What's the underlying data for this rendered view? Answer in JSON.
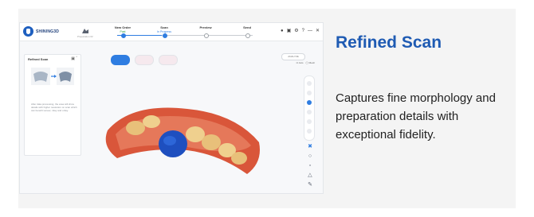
{
  "card": {
    "title": "Refined Scan",
    "description": "Captures fine morphology and preparation details with exceptional fidelity."
  },
  "app": {
    "logo_text": "SHINING3D",
    "doc_sub": "Preparation 02",
    "steps": [
      {
        "name": "New Order",
        "status": "Past",
        "status_color": "#2f9e44"
      },
      {
        "name": "Scan",
        "status": "In Progress",
        "status_color": "#2f7de1"
      },
      {
        "name": "Preview",
        "status": "",
        "status_color": "#999999"
      },
      {
        "name": "Send",
        "status": "",
        "status_color": "#999999"
      }
    ],
    "progress_fraction": 0.33,
    "window_controls": [
      "?",
      "—",
      "✕"
    ],
    "panel": {
      "title": "Refined Scan",
      "description": "After data processing, the area will show details with higher resolution on scan which can benefit veneer, inlay and onlay."
    },
    "toggle_label": "ANALYZE",
    "options": [
      "⊡ Axis",
      "◯ Mesh"
    ]
  },
  "colors": {
    "accent": "#2f7de1",
    "title_blue": "#1f5bb3",
    "gum": "#d9563a",
    "tooth": "#e8c07a",
    "highlight": "#1e4fbf"
  },
  "icons": {
    "logo": "tooth-logo-icon",
    "doc": "tooth-document-icon",
    "user": "user-icon",
    "settings": "gear-icon"
  }
}
